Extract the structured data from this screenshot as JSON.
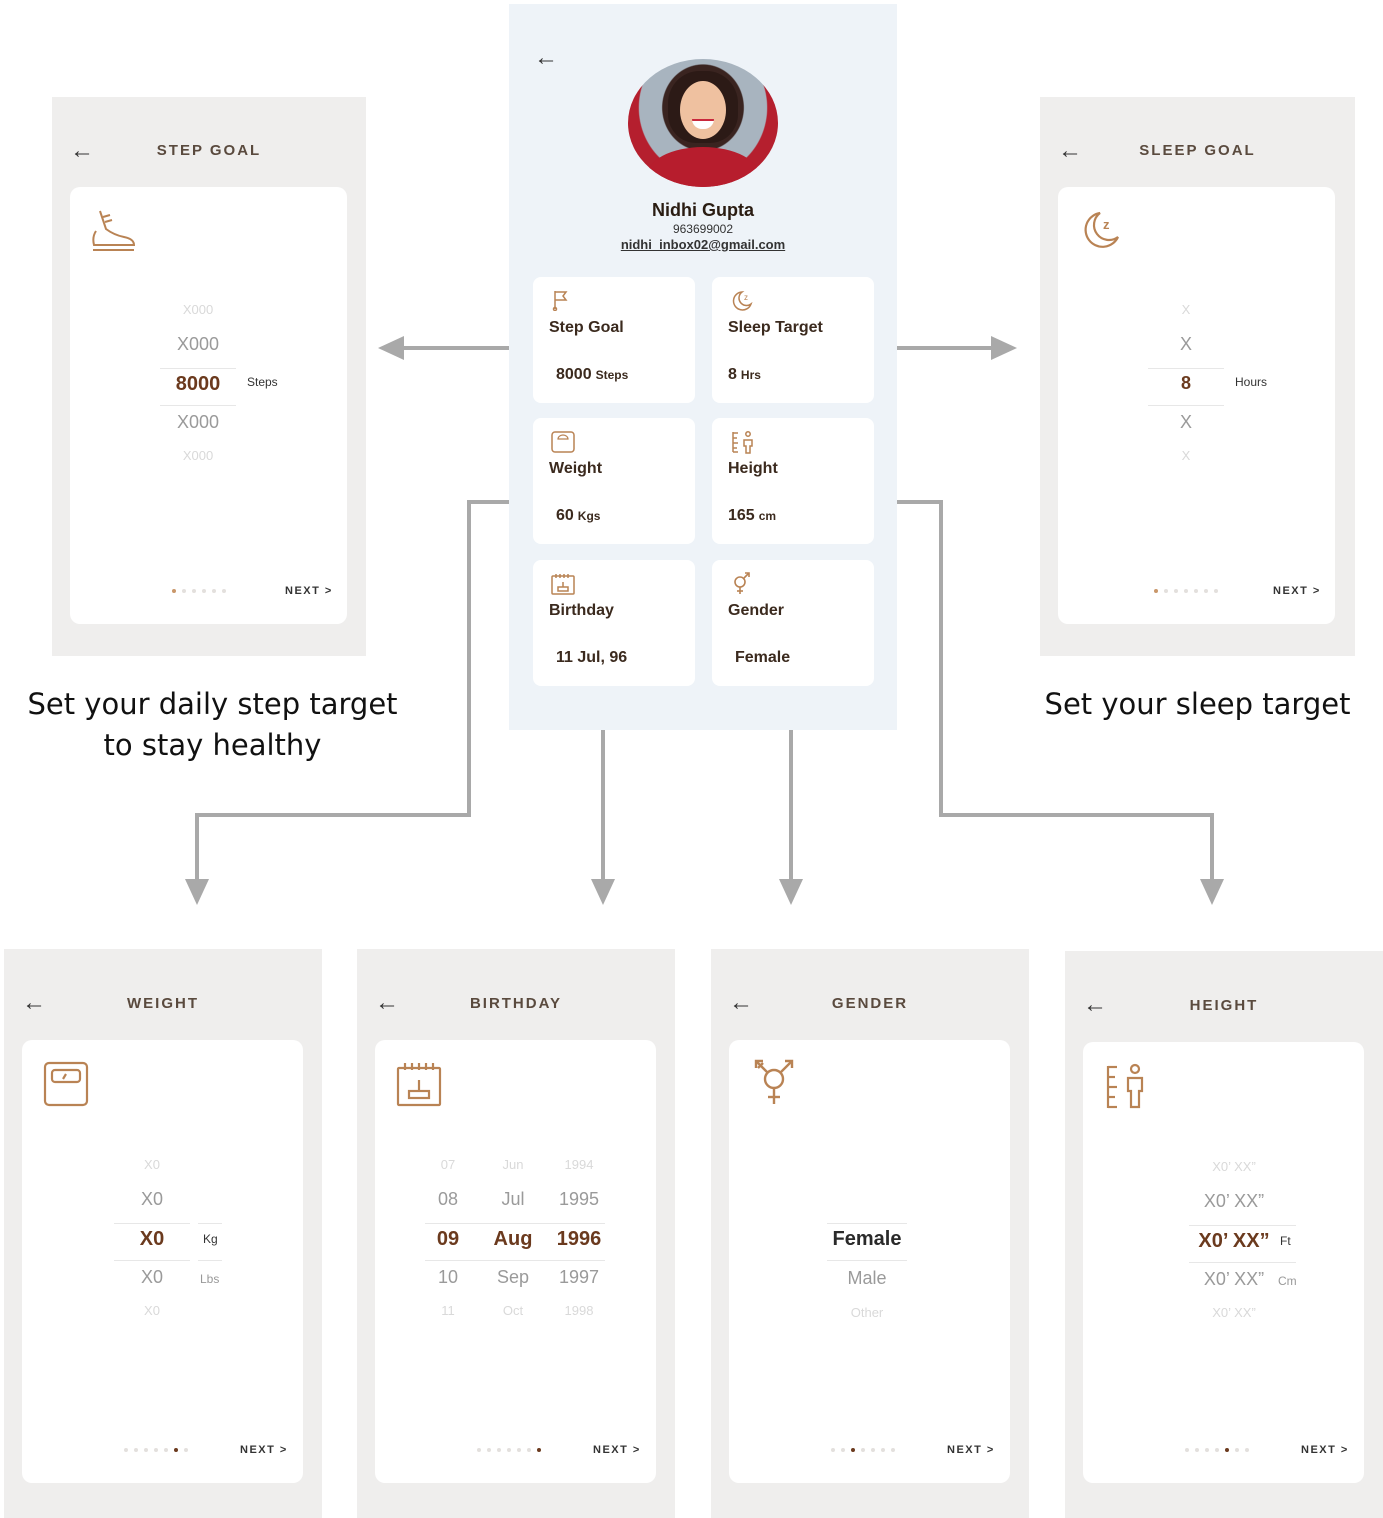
{
  "profile": {
    "name": "Nidhi Gupta",
    "phone": "963699002",
    "email": "nidhi_inbox02@gmail.com",
    "back_icon": "left-arrow-icon",
    "tiles": {
      "step": {
        "label": "Step Goal",
        "value": "8000",
        "unit": "Steps",
        "icon": "flag-icon"
      },
      "sleep": {
        "label": "Sleep Target",
        "value": "8",
        "unit": "Hrs",
        "icon": "moon-icon"
      },
      "weight": {
        "label": "Weight",
        "value": "60",
        "unit": "Kgs",
        "icon": "scale-icon"
      },
      "height": {
        "label": "Height",
        "value": "165",
        "unit": "cm",
        "icon": "ruler-person-icon"
      },
      "birthday": {
        "label": "Birthday",
        "value": "11 Jul, 96",
        "icon": "cake-icon"
      },
      "gender": {
        "label": "Gender",
        "value": "Female",
        "icon": "gender-icon"
      }
    }
  },
  "step_goal": {
    "title": "STEP GOAL",
    "wheel": [
      "X000",
      "X000",
      "8000",
      "X000",
      "X000"
    ],
    "unit": "Steps",
    "next": "NEXT >",
    "caption": [
      "Set your daily step target",
      "to stay healthy"
    ]
  },
  "sleep_goal": {
    "title": "SLEEP GOAL",
    "wheel": [
      "X",
      "X",
      "8",
      "X",
      "X"
    ],
    "unit": "Hours",
    "next": "NEXT >",
    "caption": [
      "Set your sleep target"
    ]
  },
  "weight": {
    "title": "WEIGHT",
    "wheel": [
      "X0",
      "X0",
      "X0",
      "X0",
      "X0"
    ],
    "unit_selected": "Kg",
    "unit_other": "Lbs",
    "next": "NEXT >"
  },
  "birthday": {
    "title": "BIRTHDAY",
    "days": [
      "07",
      "08",
      "09",
      "10",
      "11"
    ],
    "months": [
      "Jun",
      "Jul",
      "Aug",
      "Sep",
      "Oct"
    ],
    "years": [
      "1994",
      "1995",
      "1996",
      "1997",
      "1998"
    ],
    "next": "NEXT >"
  },
  "gender": {
    "title": "GENDER",
    "options": [
      "Female",
      "Male",
      "Other"
    ],
    "next": "NEXT >"
  },
  "height": {
    "title": "HEIGHT",
    "wheel": [
      "X0’ XX”",
      "X0’ XX”",
      "X0’ XX”",
      "X0’ XX”",
      "X0’ XX”"
    ],
    "unit_selected": "Ft",
    "unit_other": "Cm",
    "next": "NEXT >"
  },
  "colors": {
    "accent": "#c9976a",
    "arrow": "#a9a9a9",
    "dark_text": "#3b2a1e"
  }
}
